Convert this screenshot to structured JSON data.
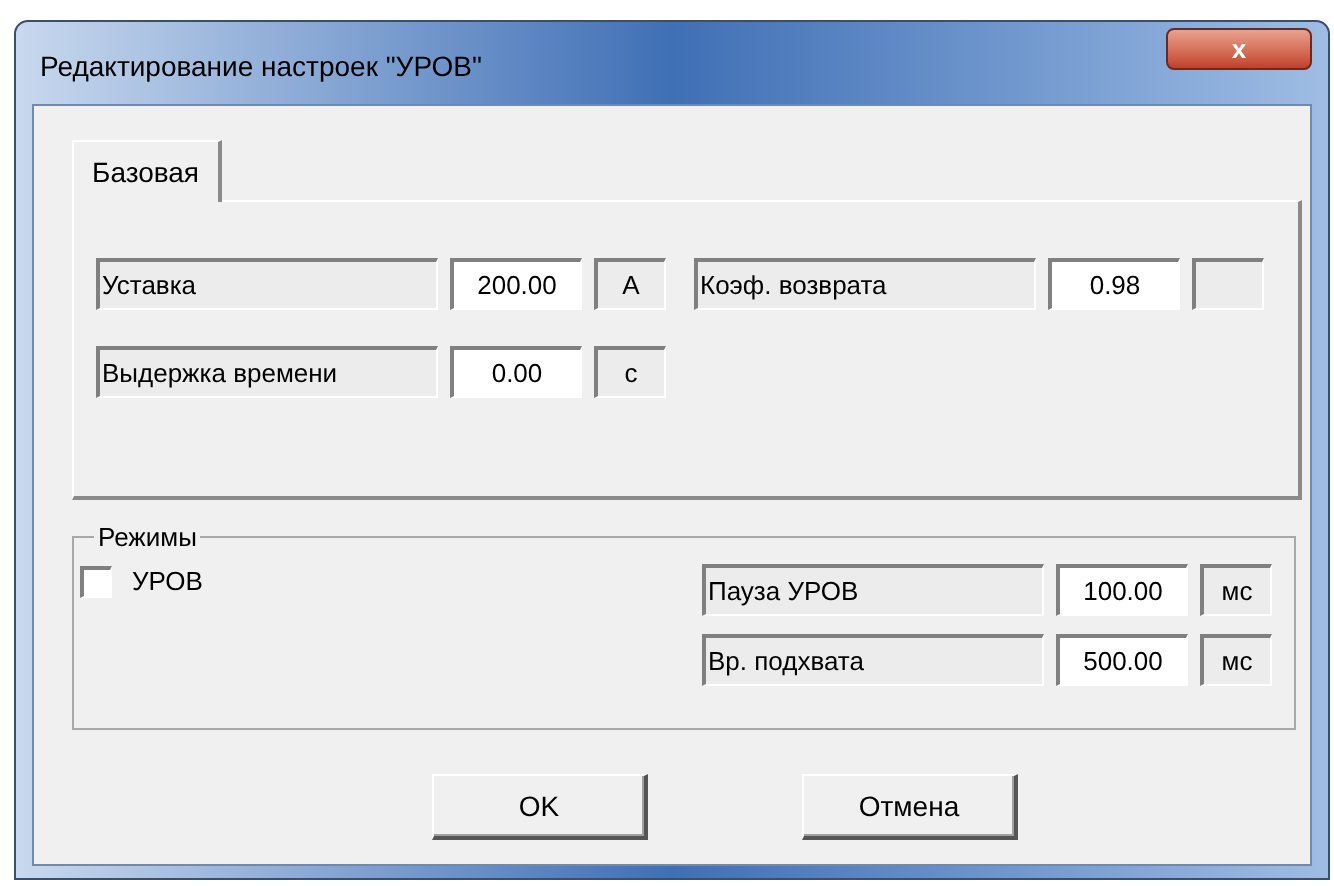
{
  "window": {
    "title": "Редактирование настроек \"УРОВ\"",
    "close": "x"
  },
  "tabs": [
    {
      "label": "Базовая",
      "selected": true
    }
  ],
  "base_rows": [
    [
      {
        "label": "Уставка",
        "value": "200.00",
        "unit": "А"
      },
      {
        "label": "Коэф. возврата",
        "value": "0.98"
      }
    ],
    [
      {
        "label": "Выдержка времени",
        "value": "0.00",
        "unit": "с"
      }
    ]
  ],
  "modes": {
    "title": "Режимы",
    "checkbox": {
      "label": "УРОВ",
      "checked": false
    },
    "fields": [
      {
        "label": "Пауза УРОВ",
        "value": "100.00",
        "unit": "мс"
      },
      {
        "label": "Вр. подхвата",
        "value": "500.00",
        "unit": "мс"
      }
    ]
  },
  "buttons": [
    "OK",
    "Отмена"
  ]
}
